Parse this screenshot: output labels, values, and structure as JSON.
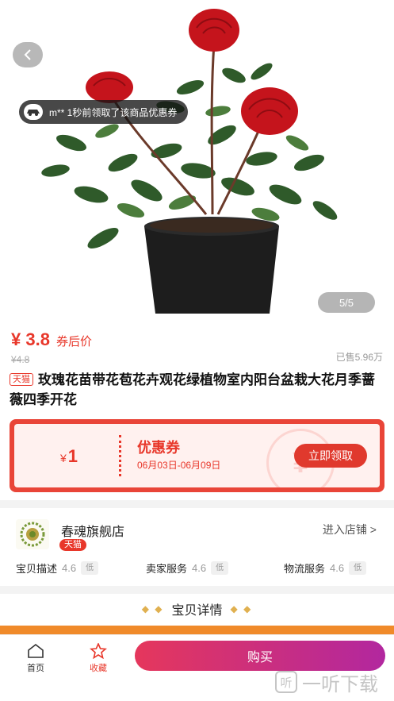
{
  "gallery": {
    "notice": "m** 1秒前领取了该商品优惠券",
    "page_indicator": "5/5"
  },
  "price": {
    "current": "¥ 3.8",
    "label": "券后价",
    "original": "¥4.8",
    "sold": "已售5.96万"
  },
  "product": {
    "platform_tag": "天猫",
    "title": "玫瑰花苗带花苞花卉观花绿植物室内阳台盆栽大花月季蔷薇四季开花"
  },
  "coupon": {
    "currency": "¥",
    "amount": "1",
    "title": "优惠券",
    "date_range": "06月03日-06月09日",
    "button": "立即领取"
  },
  "store": {
    "name": "春魂旗舰店",
    "tag": "天猫",
    "enter": "进入店铺 >",
    "ratings": [
      {
        "label": "宝贝描述",
        "score": "4.6",
        "level": "低"
      },
      {
        "label": "卖家服务",
        "score": "4.6",
        "level": "低"
      },
      {
        "label": "物流服务",
        "score": "4.6",
        "level": "低"
      }
    ]
  },
  "detail": {
    "title": "宝贝详情"
  },
  "bottom_bar": {
    "home": "首页",
    "favorite": "收藏",
    "buy": "购买"
  },
  "colors": {
    "accent": "#e8372a",
    "buy_gradient_start": "#e5375c",
    "buy_gradient_end": "#b2279f"
  },
  "icons": [
    "back-arrow-icon",
    "car-avatar-icon",
    "home-icon",
    "star-icon"
  ]
}
